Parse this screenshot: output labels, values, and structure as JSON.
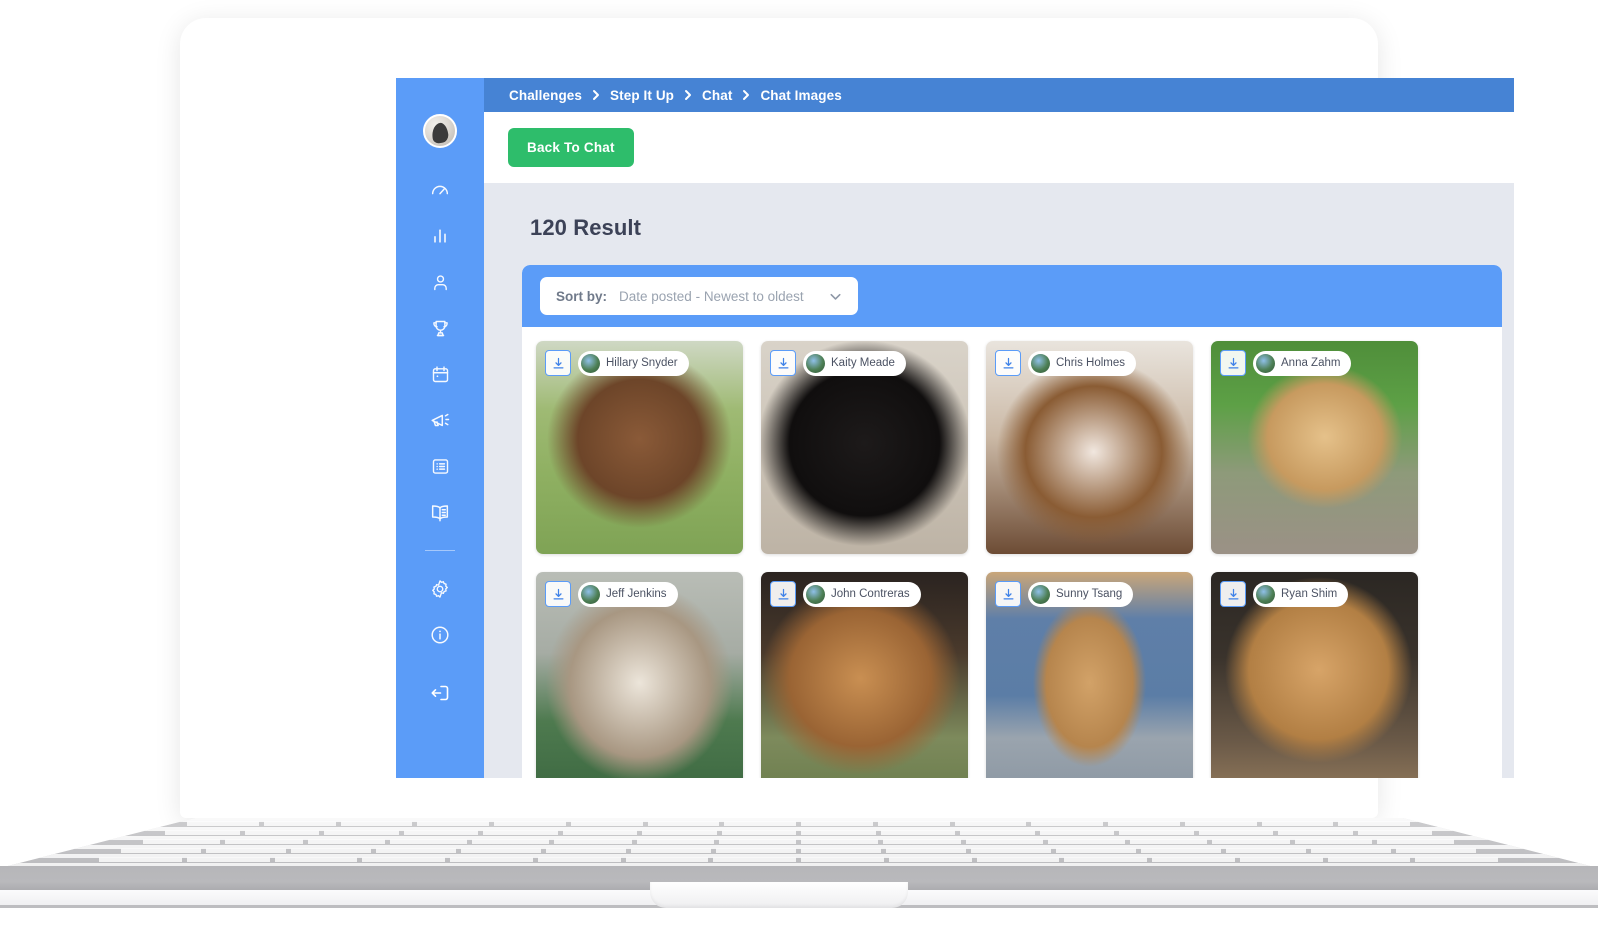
{
  "breadcrumb": {
    "items": [
      "Challenges",
      "Step It Up",
      "Chat",
      "Chat Images"
    ],
    "separator": "›"
  },
  "toolbar": {
    "back_label": "Back To Chat"
  },
  "results": {
    "count_label": "120 Result"
  },
  "sort": {
    "label": "Sort by:",
    "value": "Date posted - Newest to oldest",
    "chevron": "chevron-down-icon",
    "options": [
      "Date posted - Newest to oldest"
    ]
  },
  "colors": {
    "sidebar_blue": "#5b9cf8",
    "breadcrumb_blue": "#4683d4",
    "green_button": "#2ebd6b",
    "panel_gray": "#e5e8ef",
    "card_white": "#ffffff",
    "title_text": "#3c4257"
  },
  "sidebar": {
    "avatar": "user-avatar",
    "items": [
      {
        "icon": "gauge-icon",
        "name": "dashboard"
      },
      {
        "icon": "bar-chart-icon",
        "name": "reports"
      },
      {
        "icon": "person-icon",
        "name": "profile"
      },
      {
        "icon": "trophy-icon",
        "name": "challenges"
      },
      {
        "icon": "calendar-icon",
        "name": "calendar"
      },
      {
        "icon": "megaphone-icon",
        "name": "announcements"
      },
      {
        "icon": "list-icon",
        "name": "activities"
      },
      {
        "icon": "book-icon",
        "name": "resources"
      },
      {
        "icon": "gear-icon",
        "name": "settings"
      },
      {
        "icon": "info-icon",
        "name": "help"
      }
    ],
    "logout": {
      "icon": "logout-icon",
      "name": "logout"
    }
  },
  "gallery": {
    "download_icon": "download-icon",
    "tiles": [
      {
        "name": "Hillary Snyder",
        "photo": "brindle-pit-bull-on-grass"
      },
      {
        "name": "Kaity Meade",
        "photo": "black-fluffy-dog"
      },
      {
        "name": "Chris Holmes",
        "photo": "english-bulldog"
      },
      {
        "name": "Anna Zahm",
        "photo": "chihuahua-in-garden"
      },
      {
        "name": "Jeff Jenkins",
        "photo": "husky-smiling"
      },
      {
        "name": "John Contreras",
        "photo": "boxer-dog"
      },
      {
        "name": "Sunny Tsang",
        "photo": "dog-with-bowtie-on-chair"
      },
      {
        "name": "Ryan Shim",
        "photo": "dog-with-colorful-scarf"
      }
    ]
  }
}
